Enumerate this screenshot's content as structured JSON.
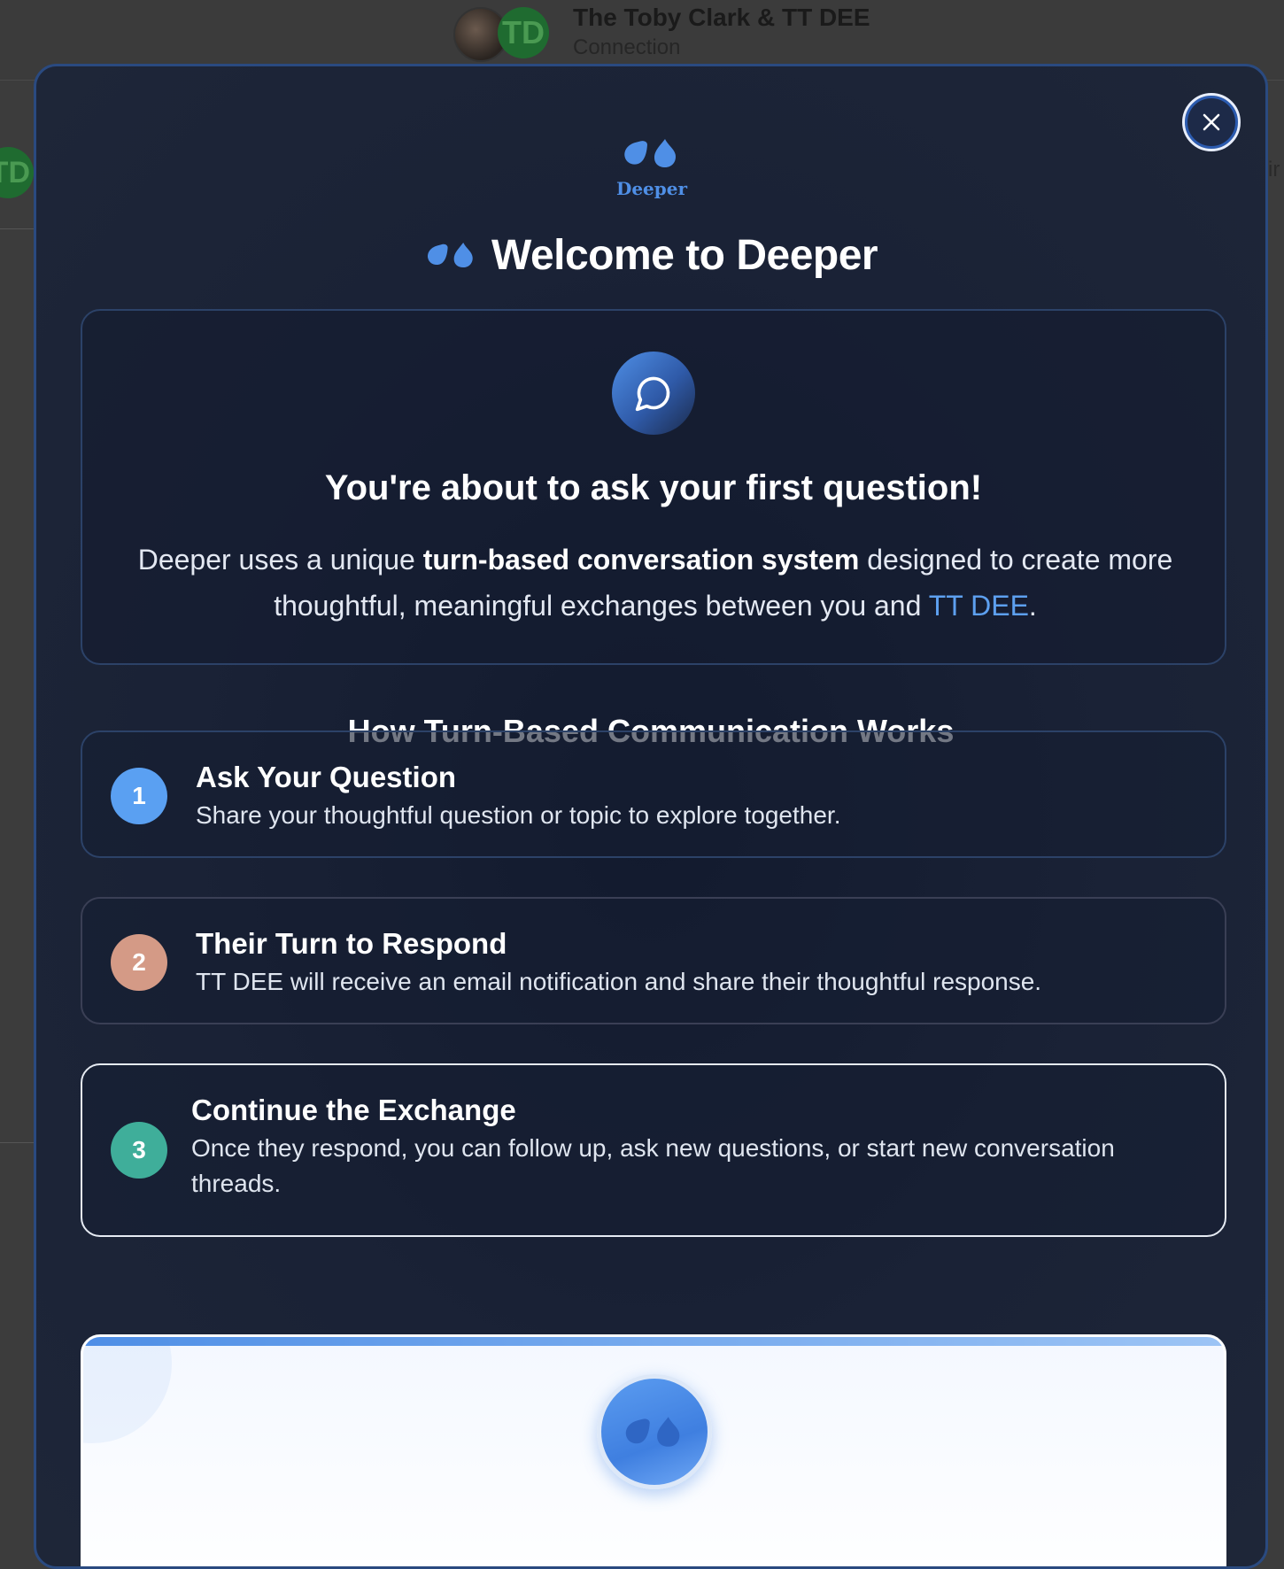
{
  "background": {
    "conversation_title": "The Toby Clark & TT DEE",
    "conversation_subtitle": "Connection",
    "avatar_initials": "TD",
    "edge_text": "ir"
  },
  "modal": {
    "logo_text": "Deeper",
    "title": "Welcome to Deeper",
    "intro": {
      "heading": "You're about to ask your first question!",
      "body_prefix": "Deeper uses a unique ",
      "body_bold": "turn-based conversation system",
      "body_middle": " designed to create more thoughtful, meaningful exchanges between you and ",
      "body_name": "TT DEE",
      "body_suffix": "."
    },
    "how_heading": "How Turn-Based Communication Works",
    "steps": [
      {
        "number": "1",
        "title": "Ask Your Question",
        "description": "Share your thoughtful question or topic to explore together.",
        "color": "#5aa0f2"
      },
      {
        "number": "2",
        "title": "Their Turn to Respond",
        "description": "TT DEE will receive an email notification and share their thoughtful response.",
        "color": "#d49a86"
      },
      {
        "number": "3",
        "title": "Continue the Exchange",
        "description": "Once they respond, you can follow up, ask new questions, or start new conversation threads.",
        "color": "#3fae9a"
      }
    ]
  },
  "colors": {
    "accent": "#4f8fe6",
    "modal_bg": "#1a2236",
    "card_border": "#2c4268"
  },
  "icons": {
    "close": "close-icon",
    "logo": "quote-bubbles-icon",
    "chat": "chat-bubble-icon"
  }
}
